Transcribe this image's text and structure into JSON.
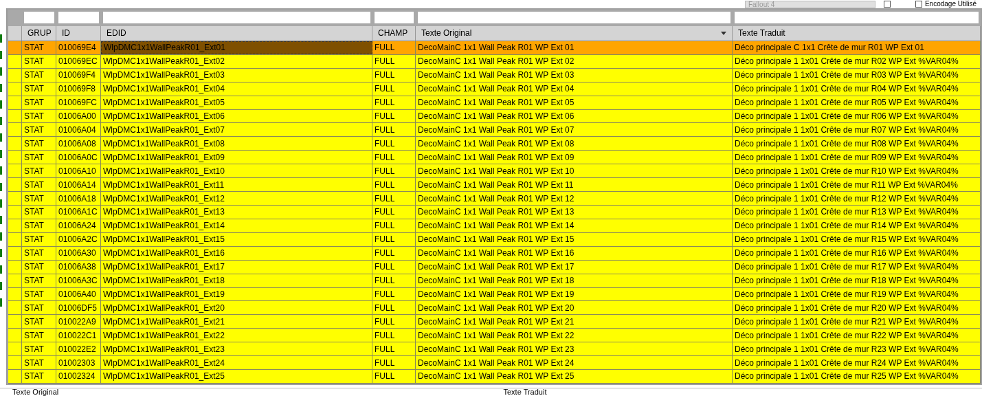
{
  "top_bar": {
    "game_dropdown": "Fallout 4",
    "checkbox": {
      "checked": false
    },
    "encoding_checkbox": {
      "label": "Encodage Utilisé",
      "checked": false
    }
  },
  "table": {
    "columns": [
      {
        "label": "GRUP",
        "focused": false,
        "sort_menu": false
      },
      {
        "label": "ID",
        "focused": false,
        "sort_menu": false
      },
      {
        "label": "EDID",
        "focused": true,
        "sort_menu": false
      },
      {
        "label": "CHAMP",
        "focused": false,
        "sort_menu": false
      },
      {
        "label": "Texte Original",
        "focused": false,
        "sort_menu": true
      },
      {
        "label": "Texte Traduit",
        "focused": false,
        "sort_menu": false
      }
    ],
    "rows": [
      {
        "selected": true,
        "cells": [
          "STAT",
          "010069E4",
          "WlpDMC1x1WallPeakR01_Ext01",
          "FULL",
          "DecoMainC 1x1 Wall Peak R01 WP Ext 01",
          "Déco principale C 1x1 Crête de mur R01 WP Ext 01"
        ]
      },
      {
        "selected": false,
        "cells": [
          "STAT",
          "010069EC",
          "WlpDMC1x1WallPeakR01_Ext02",
          "FULL",
          "DecoMainC 1x1 Wall Peak R01 WP Ext 02",
          "Déco principale 1 1x01 Crête de mur R02 WP Ext %VAR04%"
        ]
      },
      {
        "selected": false,
        "cells": [
          "STAT",
          "010069F4",
          "WlpDMC1x1WallPeakR01_Ext03",
          "FULL",
          "DecoMainC 1x1 Wall Peak R01 WP Ext 03",
          "Déco principale 1 1x01 Crête de mur R03 WP Ext %VAR04%"
        ]
      },
      {
        "selected": false,
        "cells": [
          "STAT",
          "010069F8",
          "WlpDMC1x1WallPeakR01_Ext04",
          "FULL",
          "DecoMainC 1x1 Wall Peak R01 WP Ext 04",
          "Déco principale 1 1x01 Crête de mur R04 WP Ext %VAR04%"
        ]
      },
      {
        "selected": false,
        "cells": [
          "STAT",
          "010069FC",
          "WlpDMC1x1WallPeakR01_Ext05",
          "FULL",
          "DecoMainC 1x1 Wall Peak R01 WP Ext 05",
          "Déco principale 1 1x01 Crête de mur R05 WP Ext %VAR04%"
        ]
      },
      {
        "selected": false,
        "cells": [
          "STAT",
          "01006A00",
          "WlpDMC1x1WallPeakR01_Ext06",
          "FULL",
          "DecoMainC 1x1 Wall Peak R01 WP Ext 06",
          "Déco principale 1 1x01 Crête de mur R06 WP Ext %VAR04%"
        ]
      },
      {
        "selected": false,
        "cells": [
          "STAT",
          "01006A04",
          "WlpDMC1x1WallPeakR01_Ext07",
          "FULL",
          "DecoMainC 1x1 Wall Peak R01 WP Ext 07",
          "Déco principale 1 1x01 Crête de mur R07 WP Ext %VAR04%"
        ]
      },
      {
        "selected": false,
        "cells": [
          "STAT",
          "01006A08",
          "WlpDMC1x1WallPeakR01_Ext08",
          "FULL",
          "DecoMainC 1x1 Wall Peak R01 WP Ext 08",
          "Déco principale 1 1x01 Crête de mur R08 WP Ext %VAR04%"
        ]
      },
      {
        "selected": false,
        "cells": [
          "STAT",
          "01006A0C",
          "WlpDMC1x1WallPeakR01_Ext09",
          "FULL",
          "DecoMainC 1x1 Wall Peak R01 WP Ext 09",
          "Déco principale 1 1x01 Crête de mur R09 WP Ext %VAR04%"
        ]
      },
      {
        "selected": false,
        "cells": [
          "STAT",
          "01006A10",
          "WlpDMC1x1WallPeakR01_Ext10",
          "FULL",
          "DecoMainC 1x1 Wall Peak R01 WP Ext 10",
          "Déco principale 1 1x01 Crête de mur R10 WP Ext %VAR04%"
        ]
      },
      {
        "selected": false,
        "cells": [
          "STAT",
          "01006A14",
          "WlpDMC1x1WallPeakR01_Ext11",
          "FULL",
          "DecoMainC 1x1 Wall Peak R01 WP Ext 11",
          "Déco principale 1 1x01 Crête de mur R11 WP Ext %VAR04%"
        ]
      },
      {
        "selected": false,
        "cells": [
          "STAT",
          "01006A18",
          "WlpDMC1x1WallPeakR01_Ext12",
          "FULL",
          "DecoMainC 1x1 Wall Peak R01 WP Ext 12",
          "Déco principale 1 1x01 Crête de mur R12 WP Ext %VAR04%"
        ]
      },
      {
        "selected": false,
        "cells": [
          "STAT",
          "01006A1C",
          "WlpDMC1x1WallPeakR01_Ext13",
          "FULL",
          "DecoMainC 1x1 Wall Peak R01 WP Ext 13",
          "Déco principale 1 1x01 Crête de mur R13 WP Ext %VAR04%"
        ]
      },
      {
        "selected": false,
        "cells": [
          "STAT",
          "01006A24",
          "WlpDMC1x1WallPeakR01_Ext14",
          "FULL",
          "DecoMainC 1x1 Wall Peak R01 WP Ext 14",
          "Déco principale 1 1x01 Crête de mur R14 WP Ext %VAR04%"
        ]
      },
      {
        "selected": false,
        "cells": [
          "STAT",
          "01006A2C",
          "WlpDMC1x1WallPeakR01_Ext15",
          "FULL",
          "DecoMainC 1x1 Wall Peak R01 WP Ext 15",
          "Déco principale 1 1x01 Crête de mur R15 WP Ext %VAR04%"
        ]
      },
      {
        "selected": false,
        "cells": [
          "STAT",
          "01006A30",
          "WlpDMC1x1WallPeakR01_Ext16",
          "FULL",
          "DecoMainC 1x1 Wall Peak R01 WP Ext 16",
          "Déco principale 1 1x01 Crête de mur R16 WP Ext %VAR04%"
        ]
      },
      {
        "selected": false,
        "cells": [
          "STAT",
          "01006A38",
          "WlpDMC1x1WallPeakR01_Ext17",
          "FULL",
          "DecoMainC 1x1 Wall Peak R01 WP Ext 17",
          "Déco principale 1 1x01 Crête de mur R17 WP Ext %VAR04%"
        ]
      },
      {
        "selected": false,
        "cells": [
          "STAT",
          "01006A3C",
          "WlpDMC1x1WallPeakR01_Ext18",
          "FULL",
          "DecoMainC 1x1 Wall Peak R01 WP Ext 18",
          "Déco principale 1 1x01 Crête de mur R18 WP Ext %VAR04%"
        ]
      },
      {
        "selected": false,
        "cells": [
          "STAT",
          "01006A40",
          "WlpDMC1x1WallPeakR01_Ext19",
          "FULL",
          "DecoMainC 1x1 Wall Peak R01 WP Ext 19",
          "Déco principale 1 1x01 Crête de mur R19 WP Ext %VAR04%"
        ]
      },
      {
        "selected": false,
        "cells": [
          "STAT",
          "01006DF5",
          "WlpDMC1x1WallPeakR01_Ext20",
          "FULL",
          "DecoMainC 1x1 Wall Peak R01 WP Ext 20",
          "Déco principale 1 1x01 Crête de mur R20 WP Ext %VAR04%"
        ]
      },
      {
        "selected": false,
        "cells": [
          "STAT",
          "010022A9",
          "WlpDMC1x1WallPeakR01_Ext21",
          "FULL",
          "DecoMainC 1x1 Wall Peak R01 WP Ext 21",
          "Déco principale 1 1x01 Crête de mur R21 WP Ext %VAR04%"
        ]
      },
      {
        "selected": false,
        "cells": [
          "STAT",
          "010022C1",
          "WlpDMC1x1WallPeakR01_Ext22",
          "FULL",
          "DecoMainC 1x1 Wall Peak R01 WP Ext 22",
          "Déco principale 1 1x01 Crête de mur R22 WP Ext %VAR04%"
        ]
      },
      {
        "selected": false,
        "cells": [
          "STAT",
          "010022E2",
          "WlpDMC1x1WallPeakR01_Ext23",
          "FULL",
          "DecoMainC 1x1 Wall Peak R01 WP Ext 23",
          "Déco principale 1 1x01 Crête de mur R23 WP Ext %VAR04%"
        ]
      },
      {
        "selected": false,
        "cells": [
          "STAT",
          "01002303",
          "WlpDMC1x1WallPeakR01_Ext24",
          "FULL",
          "DecoMainC 1x1 Wall Peak R01 WP Ext 24",
          "Déco principale 1 1x01 Crête de mur R24 WP Ext %VAR04%"
        ]
      },
      {
        "selected": false,
        "cells": [
          "STAT",
          "01002324",
          "WlpDMC1x1WallPeakR01_Ext25",
          "FULL",
          "DecoMainC 1x1 Wall Peak R01 WP Ext 25",
          "Déco principale 1 1x01 Crête de mur R25 WP Ext %VAR04%"
        ]
      }
    ]
  },
  "bottom_panels": [
    {
      "label": "Texte Original"
    },
    {
      "label": "Texte Traduit"
    }
  ]
}
